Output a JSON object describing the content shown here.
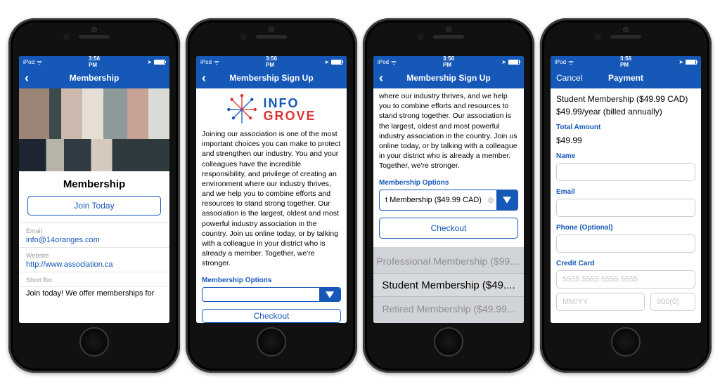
{
  "status": {
    "carrier": "iPod",
    "time": "3:56 PM"
  },
  "screen1": {
    "title": "Membership",
    "heading": "Membership",
    "join_btn": "Join Today",
    "email_label": "Email",
    "email_value": "info@14oranges.com",
    "website_label": "Website",
    "website_value": "http://www.association.ca",
    "bio_label": "Short Bio",
    "bio_text": "Join today! We offer memberships for"
  },
  "screen2": {
    "title": "Membership Sign Up",
    "logo_word1": "INFO",
    "logo_word2": "GROVE",
    "paragraph": "Joining our association is one of the most important choices you can make to protect and strengthen our industry. You and your colleagues have the incredible responsibility, and privilege of creating an environment where our industry thrives, and we help you to combine efforts and resources to stand strong together. Our association is the largest, oldest and most powerful industry association in the country. Join us online today, or by talking with a colleague in your district who is already a member. Together, we're stronger.",
    "options_label": "Membership Options",
    "select_value": "",
    "checkout_btn": "Checkout"
  },
  "screen3": {
    "title": "Membership Sign Up",
    "paragraph_continued": "where our industry thrives, and we help you to combine efforts and resources to stand strong together. Our association is the largest, oldest and most powerful industry association in the country. Join us online today, or by talking with a colleague in your district who is already a member. Together, we're stronger.",
    "options_label": "Membership Options",
    "select_value": "t Membership  ($49.99 CAD)",
    "checkout_btn": "Checkout",
    "picker": {
      "above": "Professional Membership  ($99....",
      "selected": "Student Membership  ($49....",
      "below": "Retired Membership  ($49.99..."
    }
  },
  "screen4": {
    "cancel": "Cancel",
    "title": "Payment",
    "product_line": "Student Membership ($49.99 CAD)",
    "billing_line": "$49.99/year (billed annually)",
    "total_label": "Total Amount",
    "total_value": "$49.99",
    "name_label": "Name",
    "email_label": "Email",
    "phone_label": "Phone (Optional)",
    "card_label": "Credit Card",
    "card_placeholder": "5555 5555 5555 5555",
    "exp_placeholder": "MM/YY",
    "cvv_placeholder": "000(0)"
  }
}
